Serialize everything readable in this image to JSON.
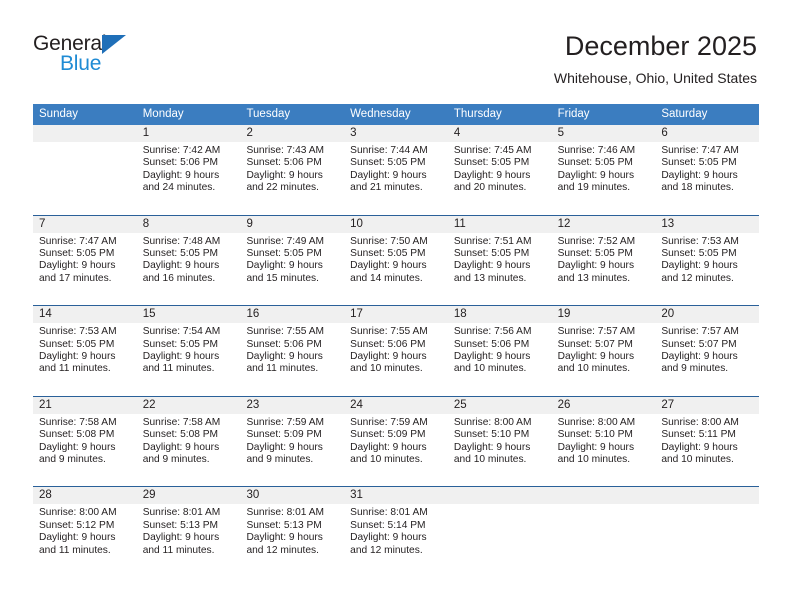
{
  "logo": {
    "word_one": "General",
    "word_two": "Blue",
    "triangle_color": "#1f6fb8",
    "blue_color": "#1f8bd4"
  },
  "header": {
    "title": "December 2025",
    "subtitle": "Whitehouse, Ohio, United States"
  },
  "colors": {
    "header_blue": "#3b7dc0",
    "rule_blue": "#2a6099",
    "day_band_gray": "#f0f0f0",
    "text": "#231f20"
  },
  "weekdays": [
    "Sunday",
    "Monday",
    "Tuesday",
    "Wednesday",
    "Thursday",
    "Friday",
    "Saturday"
  ],
  "weeks": [
    [
      {
        "day": "",
        "sunrise": "",
        "sunset": "",
        "daylight": ""
      },
      {
        "day": "1",
        "sunrise": "Sunrise: 7:42 AM",
        "sunset": "Sunset: 5:06 PM",
        "daylight": "Daylight: 9 hours and 24 minutes."
      },
      {
        "day": "2",
        "sunrise": "Sunrise: 7:43 AM",
        "sunset": "Sunset: 5:06 PM",
        "daylight": "Daylight: 9 hours and 22 minutes."
      },
      {
        "day": "3",
        "sunrise": "Sunrise: 7:44 AM",
        "sunset": "Sunset: 5:05 PM",
        "daylight": "Daylight: 9 hours and 21 minutes."
      },
      {
        "day": "4",
        "sunrise": "Sunrise: 7:45 AM",
        "sunset": "Sunset: 5:05 PM",
        "daylight": "Daylight: 9 hours and 20 minutes."
      },
      {
        "day": "5",
        "sunrise": "Sunrise: 7:46 AM",
        "sunset": "Sunset: 5:05 PM",
        "daylight": "Daylight: 9 hours and 19 minutes."
      },
      {
        "day": "6",
        "sunrise": "Sunrise: 7:47 AM",
        "sunset": "Sunset: 5:05 PM",
        "daylight": "Daylight: 9 hours and 18 minutes."
      }
    ],
    [
      {
        "day": "7",
        "sunrise": "Sunrise: 7:47 AM",
        "sunset": "Sunset: 5:05 PM",
        "daylight": "Daylight: 9 hours and 17 minutes."
      },
      {
        "day": "8",
        "sunrise": "Sunrise: 7:48 AM",
        "sunset": "Sunset: 5:05 PM",
        "daylight": "Daylight: 9 hours and 16 minutes."
      },
      {
        "day": "9",
        "sunrise": "Sunrise: 7:49 AM",
        "sunset": "Sunset: 5:05 PM",
        "daylight": "Daylight: 9 hours and 15 minutes."
      },
      {
        "day": "10",
        "sunrise": "Sunrise: 7:50 AM",
        "sunset": "Sunset: 5:05 PM",
        "daylight": "Daylight: 9 hours and 14 minutes."
      },
      {
        "day": "11",
        "sunrise": "Sunrise: 7:51 AM",
        "sunset": "Sunset: 5:05 PM",
        "daylight": "Daylight: 9 hours and 13 minutes."
      },
      {
        "day": "12",
        "sunrise": "Sunrise: 7:52 AM",
        "sunset": "Sunset: 5:05 PM",
        "daylight": "Daylight: 9 hours and 13 minutes."
      },
      {
        "day": "13",
        "sunrise": "Sunrise: 7:53 AM",
        "sunset": "Sunset: 5:05 PM",
        "daylight": "Daylight: 9 hours and 12 minutes."
      }
    ],
    [
      {
        "day": "14",
        "sunrise": "Sunrise: 7:53 AM",
        "sunset": "Sunset: 5:05 PM",
        "daylight": "Daylight: 9 hours and 11 minutes."
      },
      {
        "day": "15",
        "sunrise": "Sunrise: 7:54 AM",
        "sunset": "Sunset: 5:05 PM",
        "daylight": "Daylight: 9 hours and 11 minutes."
      },
      {
        "day": "16",
        "sunrise": "Sunrise: 7:55 AM",
        "sunset": "Sunset: 5:06 PM",
        "daylight": "Daylight: 9 hours and 11 minutes."
      },
      {
        "day": "17",
        "sunrise": "Sunrise: 7:55 AM",
        "sunset": "Sunset: 5:06 PM",
        "daylight": "Daylight: 9 hours and 10 minutes."
      },
      {
        "day": "18",
        "sunrise": "Sunrise: 7:56 AM",
        "sunset": "Sunset: 5:06 PM",
        "daylight": "Daylight: 9 hours and 10 minutes."
      },
      {
        "day": "19",
        "sunrise": "Sunrise: 7:57 AM",
        "sunset": "Sunset: 5:07 PM",
        "daylight": "Daylight: 9 hours and 10 minutes."
      },
      {
        "day": "20",
        "sunrise": "Sunrise: 7:57 AM",
        "sunset": "Sunset: 5:07 PM",
        "daylight": "Daylight: 9 hours and 9 minutes."
      }
    ],
    [
      {
        "day": "21",
        "sunrise": "Sunrise: 7:58 AM",
        "sunset": "Sunset: 5:08 PM",
        "daylight": "Daylight: 9 hours and 9 minutes."
      },
      {
        "day": "22",
        "sunrise": "Sunrise: 7:58 AM",
        "sunset": "Sunset: 5:08 PM",
        "daylight": "Daylight: 9 hours and 9 minutes."
      },
      {
        "day": "23",
        "sunrise": "Sunrise: 7:59 AM",
        "sunset": "Sunset: 5:09 PM",
        "daylight": "Daylight: 9 hours and 9 minutes."
      },
      {
        "day": "24",
        "sunrise": "Sunrise: 7:59 AM",
        "sunset": "Sunset: 5:09 PM",
        "daylight": "Daylight: 9 hours and 10 minutes."
      },
      {
        "day": "25",
        "sunrise": "Sunrise: 8:00 AM",
        "sunset": "Sunset: 5:10 PM",
        "daylight": "Daylight: 9 hours and 10 minutes."
      },
      {
        "day": "26",
        "sunrise": "Sunrise: 8:00 AM",
        "sunset": "Sunset: 5:10 PM",
        "daylight": "Daylight: 9 hours and 10 minutes."
      },
      {
        "day": "27",
        "sunrise": "Sunrise: 8:00 AM",
        "sunset": "Sunset: 5:11 PM",
        "daylight": "Daylight: 9 hours and 10 minutes."
      }
    ],
    [
      {
        "day": "28",
        "sunrise": "Sunrise: 8:00 AM",
        "sunset": "Sunset: 5:12 PM",
        "daylight": "Daylight: 9 hours and 11 minutes."
      },
      {
        "day": "29",
        "sunrise": "Sunrise: 8:01 AM",
        "sunset": "Sunset: 5:13 PM",
        "daylight": "Daylight: 9 hours and 11 minutes."
      },
      {
        "day": "30",
        "sunrise": "Sunrise: 8:01 AM",
        "sunset": "Sunset: 5:13 PM",
        "daylight": "Daylight: 9 hours and 12 minutes."
      },
      {
        "day": "31",
        "sunrise": "Sunrise: 8:01 AM",
        "sunset": "Sunset: 5:14 PM",
        "daylight": "Daylight: 9 hours and 12 minutes."
      },
      {
        "day": "",
        "sunrise": "",
        "sunset": "",
        "daylight": ""
      },
      {
        "day": "",
        "sunrise": "",
        "sunset": "",
        "daylight": ""
      },
      {
        "day": "",
        "sunrise": "",
        "sunset": "",
        "daylight": ""
      }
    ]
  ]
}
